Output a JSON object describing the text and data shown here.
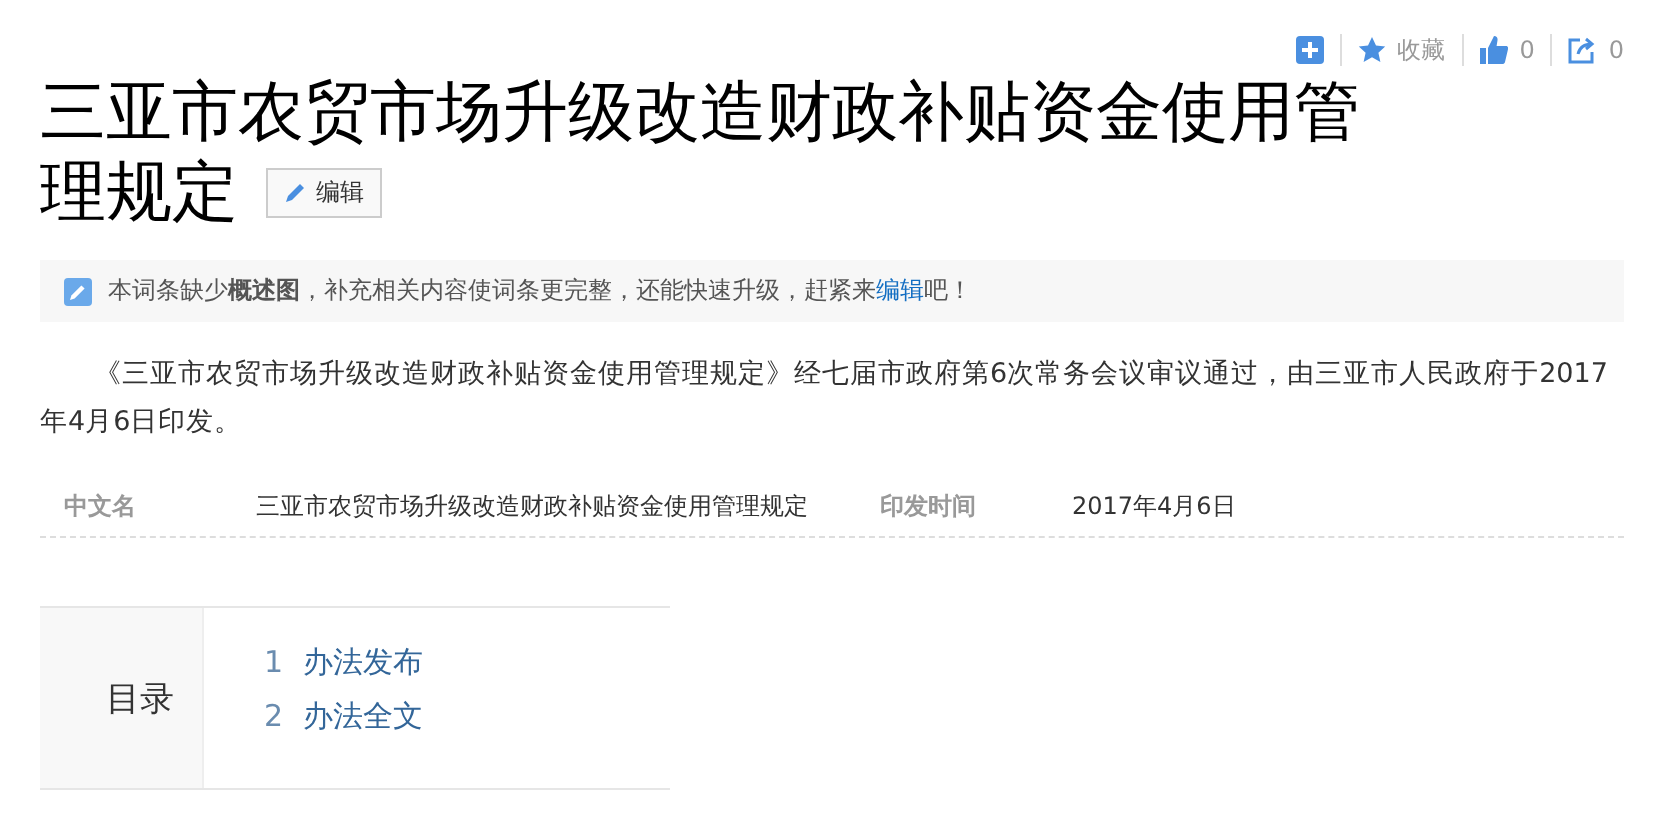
{
  "toolbar": {
    "favorite_label": "收藏",
    "like_count": "0",
    "share_count": "0"
  },
  "title_lines": [
    "三亚市农贸市场升级改造财政补贴资金使用管",
    "理规定"
  ],
  "edit_button": "编辑",
  "notice": {
    "text_before": "本词条缺少**概述图**，补充相关内容使词条更完整，还能快速升级，赶紧来",
    "link": "编辑",
    "text_after": "吧！"
  },
  "summary": "《三亚市农贸市场升级改造财政补贴资金使用管理规定》经七届市政府第6次常务会议审议通过，由三亚市人民政府于2017年4月6日印发。",
  "basic_info": [
    {
      "name": "中文名",
      "value": "三亚市农贸市场升级改造财政补贴资金使用管理规定"
    },
    {
      "name": "印发时间",
      "value": "2017年4月6日"
    }
  ],
  "toc": {
    "heading": "目录",
    "items": [
      {
        "number": "1",
        "label": "办法发布"
      },
      {
        "number": "2",
        "label": "办法全文"
      }
    ]
  }
}
